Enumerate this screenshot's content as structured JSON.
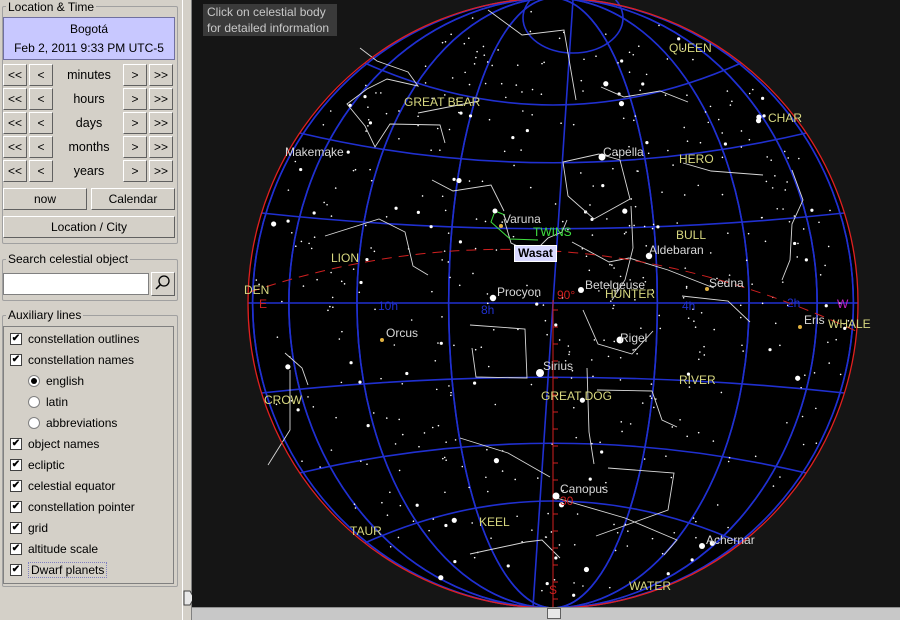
{
  "location_time": {
    "title": "Location & Time",
    "city": "Bogotá",
    "datetime": "Feb 2, 2011 9:33 PM UTC-5",
    "steps": [
      {
        "unit": "minutes"
      },
      {
        "unit": "hours"
      },
      {
        "unit": "days"
      },
      {
        "unit": "months"
      },
      {
        "unit": "years"
      }
    ],
    "fast_back": "<<",
    "back": "<",
    "fwd": ">",
    "fast_fwd": ">>",
    "now_label": "now",
    "calendar_label": "Calendar",
    "location_label": "Location / City"
  },
  "search": {
    "title": "Search celestial object",
    "value": "",
    "icon": "search-icon"
  },
  "auxiliary": {
    "title": "Auxiliary lines",
    "options": [
      {
        "label": "constellation outlines",
        "type": "checkbox",
        "checked": true
      },
      {
        "label": "constellation names",
        "type": "checkbox",
        "checked": true
      },
      {
        "label": "english",
        "type": "radio",
        "checked": true
      },
      {
        "label": "latin",
        "type": "radio",
        "checked": false
      },
      {
        "label": "abbreviations",
        "type": "radio",
        "checked": false
      },
      {
        "label": "object names",
        "type": "checkbox",
        "checked": true
      },
      {
        "label": "ecliptic",
        "type": "checkbox",
        "checked": true
      },
      {
        "label": "celestial equator",
        "type": "checkbox",
        "checked": true
      },
      {
        "label": "constellation pointer",
        "type": "checkbox",
        "checked": true
      },
      {
        "label": "grid",
        "type": "checkbox",
        "checked": true
      },
      {
        "label": "altitude scale",
        "type": "checkbox",
        "checked": true
      },
      {
        "label": "Dwarf planets",
        "type": "checkbox",
        "checked": true
      }
    ]
  },
  "sky": {
    "tooltip_line1": "Click on celestial body",
    "tooltip_line2": "for detailed information",
    "highlighted": "Wasat",
    "constellations": [
      "QUEEN",
      "GREAT BEAR",
      "CHAR",
      "HERO",
      "TWINS",
      "BULL",
      "LION",
      "DEN",
      "HUNTER",
      "WHALE",
      "CROW",
      "GREAT DOG",
      "RIVER",
      "KEEL",
      "TAUR",
      "WATER"
    ],
    "objects": [
      "Makemake",
      "Capella",
      "Varuna",
      "Aldebaran",
      "Sedna",
      "Procyon",
      "Betelgeuse",
      "Orcus",
      "Eris",
      "Rigel",
      "Sirius",
      "Canopus",
      "Achernar"
    ],
    "grid_labels": [
      "10h",
      "8h",
      "4h",
      "2h",
      "90°",
      "30",
      "E",
      "W",
      "S"
    ],
    "colors": {
      "background": "#000000",
      "grid": "#2030d0",
      "horizon": "#d02020",
      "ecliptic": "#d02020",
      "constellation_label": "#d8d880",
      "highlight": "#40e040"
    }
  }
}
